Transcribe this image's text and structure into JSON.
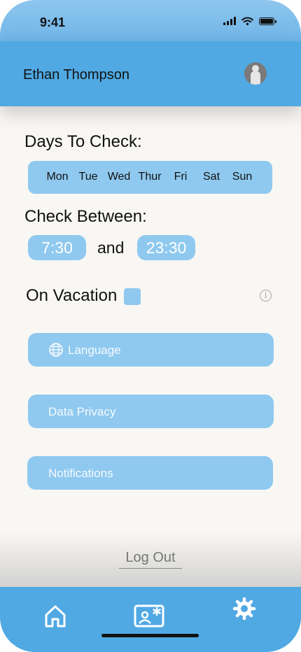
{
  "status_bar": {
    "time": "9:41",
    "icons": [
      "signal-icon",
      "wifi-icon",
      "battery-icon"
    ]
  },
  "header": {
    "user_name": "Ethan Thompson",
    "avatar_icon": "avatar-icon"
  },
  "days": {
    "title": "Days To Check:",
    "items": [
      "Mon",
      "Tue",
      "Wed",
      "Thur",
      "Fri",
      "Sat",
      "Sun"
    ]
  },
  "check_between": {
    "title": "Check Between:",
    "start_time": "7:30",
    "connector": "and",
    "end_time": "23:30"
  },
  "vacation": {
    "label": "On Vacation",
    "checked": false
  },
  "menu": {
    "language": "Language",
    "privacy": "Data Privacy",
    "notifications": "Notifications"
  },
  "logout_label": "Log Out",
  "tabs": [
    "home-icon",
    "contact-card-icon",
    "gear-icon"
  ],
  "colors": {
    "primary": "#50a9e3",
    "light": "#90c9ef",
    "background": "#f9f7f4"
  }
}
